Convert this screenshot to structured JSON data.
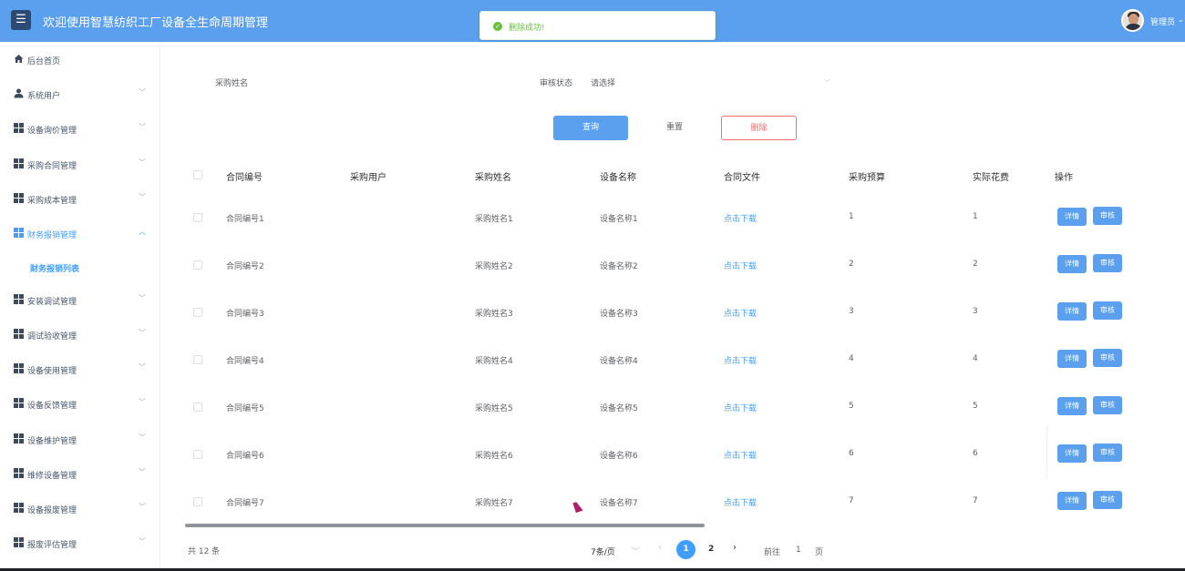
{
  "header": {
    "menu_icon": "hamburger-icon",
    "title": "欢迎使用智慧纺织工厂设备全生命周期管理",
    "user": "管理员",
    "user_caret": "⌄"
  },
  "toast": {
    "icon": "check-circle-icon",
    "message": "删除成功!"
  },
  "sidebar": {
    "items": [
      {
        "label": "后台首页",
        "icon": "home-icon",
        "has_chevron": false
      },
      {
        "label": "系统用户",
        "icon": "user-icon",
        "has_chevron": true
      },
      {
        "label": "设备询价管理",
        "icon": "grid-icon",
        "has_chevron": true
      },
      {
        "label": "采购合同管理",
        "icon": "grid-icon",
        "has_chevron": true
      },
      {
        "label": "采购成本管理",
        "icon": "grid-icon",
        "has_chevron": true
      },
      {
        "label": "财务报销管理",
        "icon": "grid-icon",
        "has_chevron": true,
        "expanded": true
      },
      {
        "label": "安装调试管理",
        "icon": "grid-icon",
        "has_chevron": true
      },
      {
        "label": "调试验收管理",
        "icon": "grid-icon",
        "has_chevron": true
      },
      {
        "label": "设备使用管理",
        "icon": "grid-icon",
        "has_chevron": true
      },
      {
        "label": "设备反馈管理",
        "icon": "grid-icon",
        "has_chevron": true
      },
      {
        "label": "设备维护管理",
        "icon": "grid-icon",
        "has_chevron": true
      },
      {
        "label": "维修设备管理",
        "icon": "grid-icon",
        "has_chevron": true
      },
      {
        "label": "设备报废管理",
        "icon": "grid-icon",
        "has_chevron": true
      },
      {
        "label": "报废评估管理",
        "icon": "grid-icon",
        "has_chevron": true
      }
    ],
    "sub_item": "财务报销列表",
    "chevron_down": "﹀",
    "chevron_up": "︿"
  },
  "search": {
    "name_label": "采购姓名",
    "name_placeholder": "",
    "status_label": "审核状态",
    "status_placeholder": "请选择",
    "query_button": "查询",
    "reset_button": "重置",
    "delete_button": "删除"
  },
  "table": {
    "columns": [
      "合同编号",
      "采购用户",
      "采购姓名",
      "设备名称",
      "合同文件",
      "采购预算",
      "实际花费",
      "操作"
    ],
    "rows": [
      {
        "contract_no": "合同编号1",
        "user": "",
        "name": "采购姓名1",
        "device": "设备名称1",
        "file": "点击下载",
        "budget": "1",
        "actual": "1"
      },
      {
        "contract_no": "合同编号2",
        "user": "",
        "name": "采购姓名2",
        "device": "设备名称2",
        "file": "点击下载",
        "budget": "2",
        "actual": "2"
      },
      {
        "contract_no": "合同编号3",
        "user": "",
        "name": "采购姓名3",
        "device": "设备名称3",
        "file": "点击下载",
        "budget": "3",
        "actual": "3"
      },
      {
        "contract_no": "合同编号4",
        "user": "",
        "name": "采购姓名4",
        "device": "设备名称4",
        "file": "点击下载",
        "budget": "4",
        "actual": "4"
      },
      {
        "contract_no": "合同编号5",
        "user": "",
        "name": "采购姓名5",
        "device": "设备名称5",
        "file": "点击下载",
        "budget": "5",
        "actual": "5"
      },
      {
        "contract_no": "合同编号6",
        "user": "",
        "name": "采购姓名6",
        "device": "设备名称6",
        "file": "点击下载",
        "budget": "6",
        "actual": "6"
      },
      {
        "contract_no": "合同编号7",
        "user": "",
        "name": "采购姓名7",
        "device": "设备名称7",
        "file": "点击下载",
        "budget": "7",
        "actual": "7"
      }
    ],
    "detail_button": "详情",
    "audit_button": "审核"
  },
  "pagination": {
    "total": "共 12 条",
    "page_size": "7条/页",
    "prev": "‹",
    "next": "›",
    "pages": [
      "1",
      "2"
    ],
    "current": "1",
    "goto_label": "前往",
    "goto_value": "1",
    "page_suffix": "页"
  }
}
